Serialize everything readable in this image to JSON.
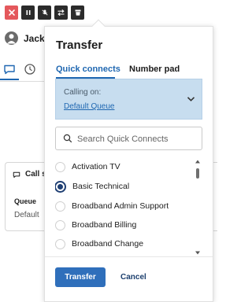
{
  "toolbar": {
    "buttons": [
      {
        "name": "end-call",
        "icon": "close-icon",
        "color": "#e4585c"
      },
      {
        "name": "hold",
        "icon": "pause-icon",
        "color": "#2b2b2b"
      },
      {
        "name": "mute",
        "icon": "mic-off-icon",
        "color": "#2b2b2b"
      },
      {
        "name": "transfer",
        "icon": "transfer-arrows-icon",
        "color": "#2b2b2b"
      },
      {
        "name": "dialpad",
        "icon": "dialpad-icon",
        "color": "#2b2b2b"
      }
    ]
  },
  "agent": {
    "name_visible": "Jack W"
  },
  "background_card": {
    "header_visible": "Call s",
    "queue_label": "Queue",
    "queue_value_visible": "Default",
    "right_fragment": "s"
  },
  "transfer": {
    "title": "Transfer",
    "tabs": [
      {
        "label": "Quick connects",
        "active": true
      },
      {
        "label": "Number pad",
        "active": false
      }
    ],
    "calling_on": {
      "label": "Calling on:",
      "value": "Default Queue"
    },
    "search": {
      "placeholder": "Search Quick Connects",
      "value": ""
    },
    "quick_connects": [
      {
        "label": "Activation TV",
        "selected": false
      },
      {
        "label": "Basic Technical",
        "selected": true
      },
      {
        "label": "Broadband Admin Support",
        "selected": false
      },
      {
        "label": "Broadband Billing",
        "selected": false
      },
      {
        "label": "Broadband Change",
        "selected": false
      }
    ],
    "actions": {
      "transfer_label": "Transfer",
      "cancel_label": "Cancel"
    }
  },
  "colors": {
    "accent": "#1f67b1",
    "primary_button": "#2f6fbb",
    "calling_bg": "#c7ddef",
    "end_call": "#e4585c"
  }
}
